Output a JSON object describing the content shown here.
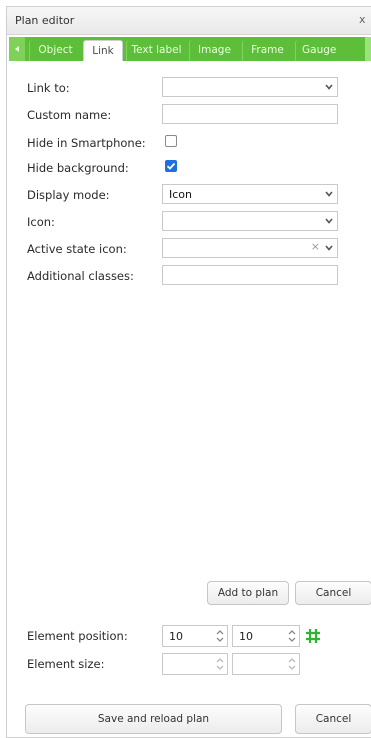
{
  "window": {
    "title": "Plan editor",
    "close_label": "x"
  },
  "tabs": [
    {
      "label": "Object"
    },
    {
      "label": "Link",
      "active": true
    },
    {
      "label": "Text label"
    },
    {
      "label": "Image"
    },
    {
      "label": "Frame"
    },
    {
      "label": "Gauge"
    }
  ],
  "form": {
    "link_to": {
      "label": "Link to:",
      "value": ""
    },
    "custom_name": {
      "label": "Custom name:",
      "value": ""
    },
    "hide_smartphone": {
      "label": "Hide in Smartphone:",
      "checked": false
    },
    "hide_background": {
      "label": "Hide background:",
      "checked": true
    },
    "display_mode": {
      "label": "Display mode:",
      "value": "Icon"
    },
    "icon": {
      "label": "Icon:",
      "value": ""
    },
    "active_state_icon": {
      "label": "Active state icon:",
      "value": "",
      "clear": "×"
    },
    "additional_classes": {
      "label": "Additional classes:",
      "value": ""
    }
  },
  "actions": {
    "add_to_plan": "Add to plan",
    "cancel": "Cancel"
  },
  "position": {
    "label": "Element position:",
    "x": "10",
    "y": "10"
  },
  "size": {
    "label": "Element size:",
    "width": "",
    "height": ""
  },
  "footer": {
    "save_reload": "Save and reload plan",
    "cancel": "Cancel"
  },
  "colors": {
    "tab_bar": "#5dbe3a",
    "checkbox_checked": "#1e6fe0",
    "grid_icon": "#2fb52f"
  }
}
